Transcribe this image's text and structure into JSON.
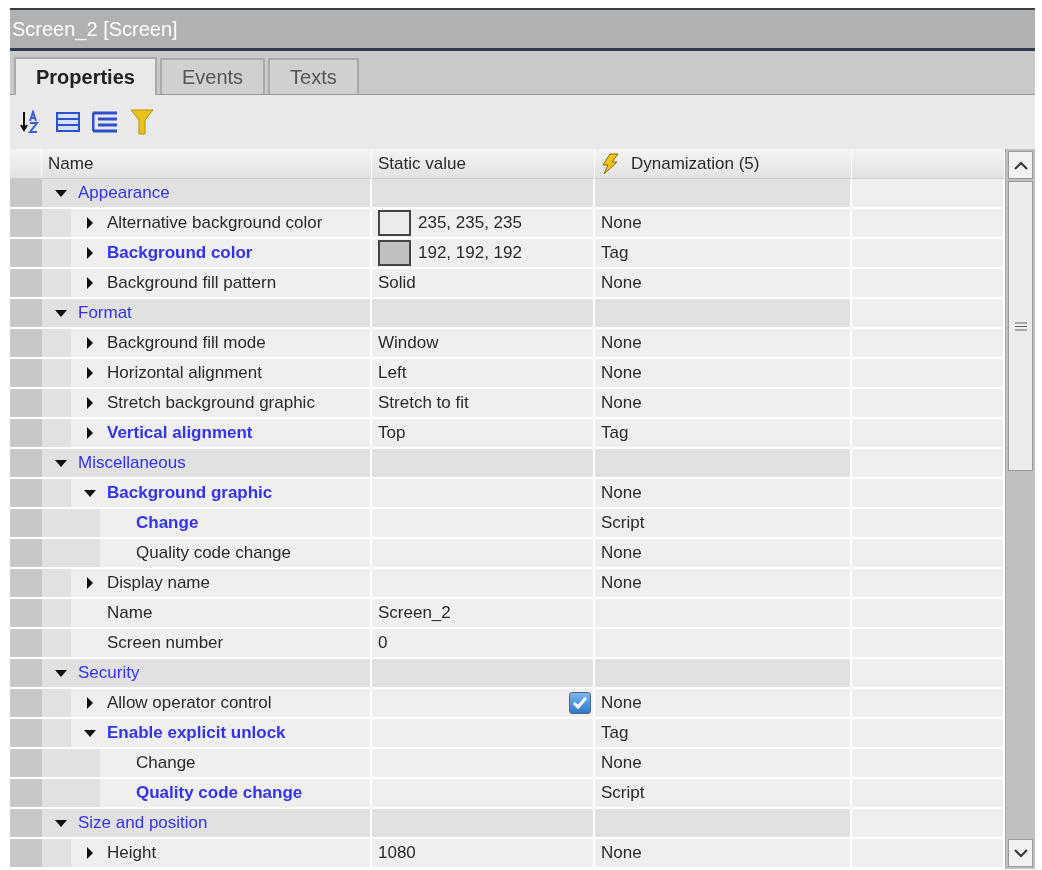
{
  "window": {
    "title": "Screen_2 [Screen]"
  },
  "tabs": [
    {
      "label": "Properties",
      "selected": true
    },
    {
      "label": "Events",
      "selected": false
    },
    {
      "label": "Texts",
      "selected": false
    }
  ],
  "table": {
    "columns": [
      "Name",
      "Static value",
      "Dynamization (5)"
    ],
    "rows": [
      {
        "name": "Appearance",
        "expanded": true,
        "children": [
          {
            "name": "Alternative background color",
            "expanded": false,
            "value": "235, 235, 235",
            "color": "#ebebeb",
            "dynamization": "None",
            "dynamized": false
          },
          {
            "name": "Background color",
            "expanded": false,
            "value": "192, 192, 192",
            "color": "#c0c0c0",
            "dynamization": "Tag",
            "dynamized": true
          },
          {
            "name": "Background fill pattern",
            "expanded": false,
            "value": "Solid",
            "dynamization": "None",
            "dynamized": false
          }
        ]
      },
      {
        "name": "Format",
        "expanded": true,
        "children": [
          {
            "name": "Background fill mode",
            "expanded": false,
            "value": "Window",
            "dynamization": "None",
            "dynamized": false
          },
          {
            "name": "Horizontal alignment",
            "expanded": false,
            "value": "Left",
            "dynamization": "None",
            "dynamized": false
          },
          {
            "name": "Stretch background graphic",
            "expanded": false,
            "value": "Stretch to fit",
            "dynamization": "None",
            "dynamized": false
          },
          {
            "name": "Vertical alignment",
            "expanded": false,
            "value": "Top",
            "dynamization": "Tag",
            "dynamized": true
          }
        ]
      },
      {
        "name": "Miscellaneous",
        "expanded": true,
        "children": [
          {
            "name": "Background graphic",
            "expanded": true,
            "dynamization": "None",
            "dynamized": true,
            "children": [
              {
                "name": "Change",
                "dynamization": "Script",
                "dynamized": true
              },
              {
                "name": "Quality code change",
                "dynamization": "None",
                "dynamized": false
              }
            ]
          },
          {
            "name": "Display name",
            "expanded": false,
            "dynamization": "None",
            "dynamized": false
          },
          {
            "name": "Name",
            "value": "Screen_2",
            "dynamized": false
          },
          {
            "name": "Screen number",
            "value": "0",
            "dynamized": false
          }
        ]
      },
      {
        "name": "Security",
        "expanded": true,
        "children": [
          {
            "name": "Allow operator control",
            "expanded": false,
            "checked": true,
            "dynamization": "None",
            "dynamized": false
          },
          {
            "name": "Enable explicit unlock",
            "expanded": true,
            "dynamization": "Tag",
            "dynamized": true,
            "children": [
              {
                "name": "Change",
                "dynamization": "None",
                "dynamized": false
              },
              {
                "name": "Quality code change",
                "dynamization": "Script",
                "dynamized": true
              }
            ]
          }
        ]
      },
      {
        "name": "Size and position",
        "expanded": true,
        "children": [
          {
            "name": "Height",
            "expanded": false,
            "value": "1080",
            "dynamization": "None",
            "dynamized": false
          }
        ]
      }
    ]
  }
}
